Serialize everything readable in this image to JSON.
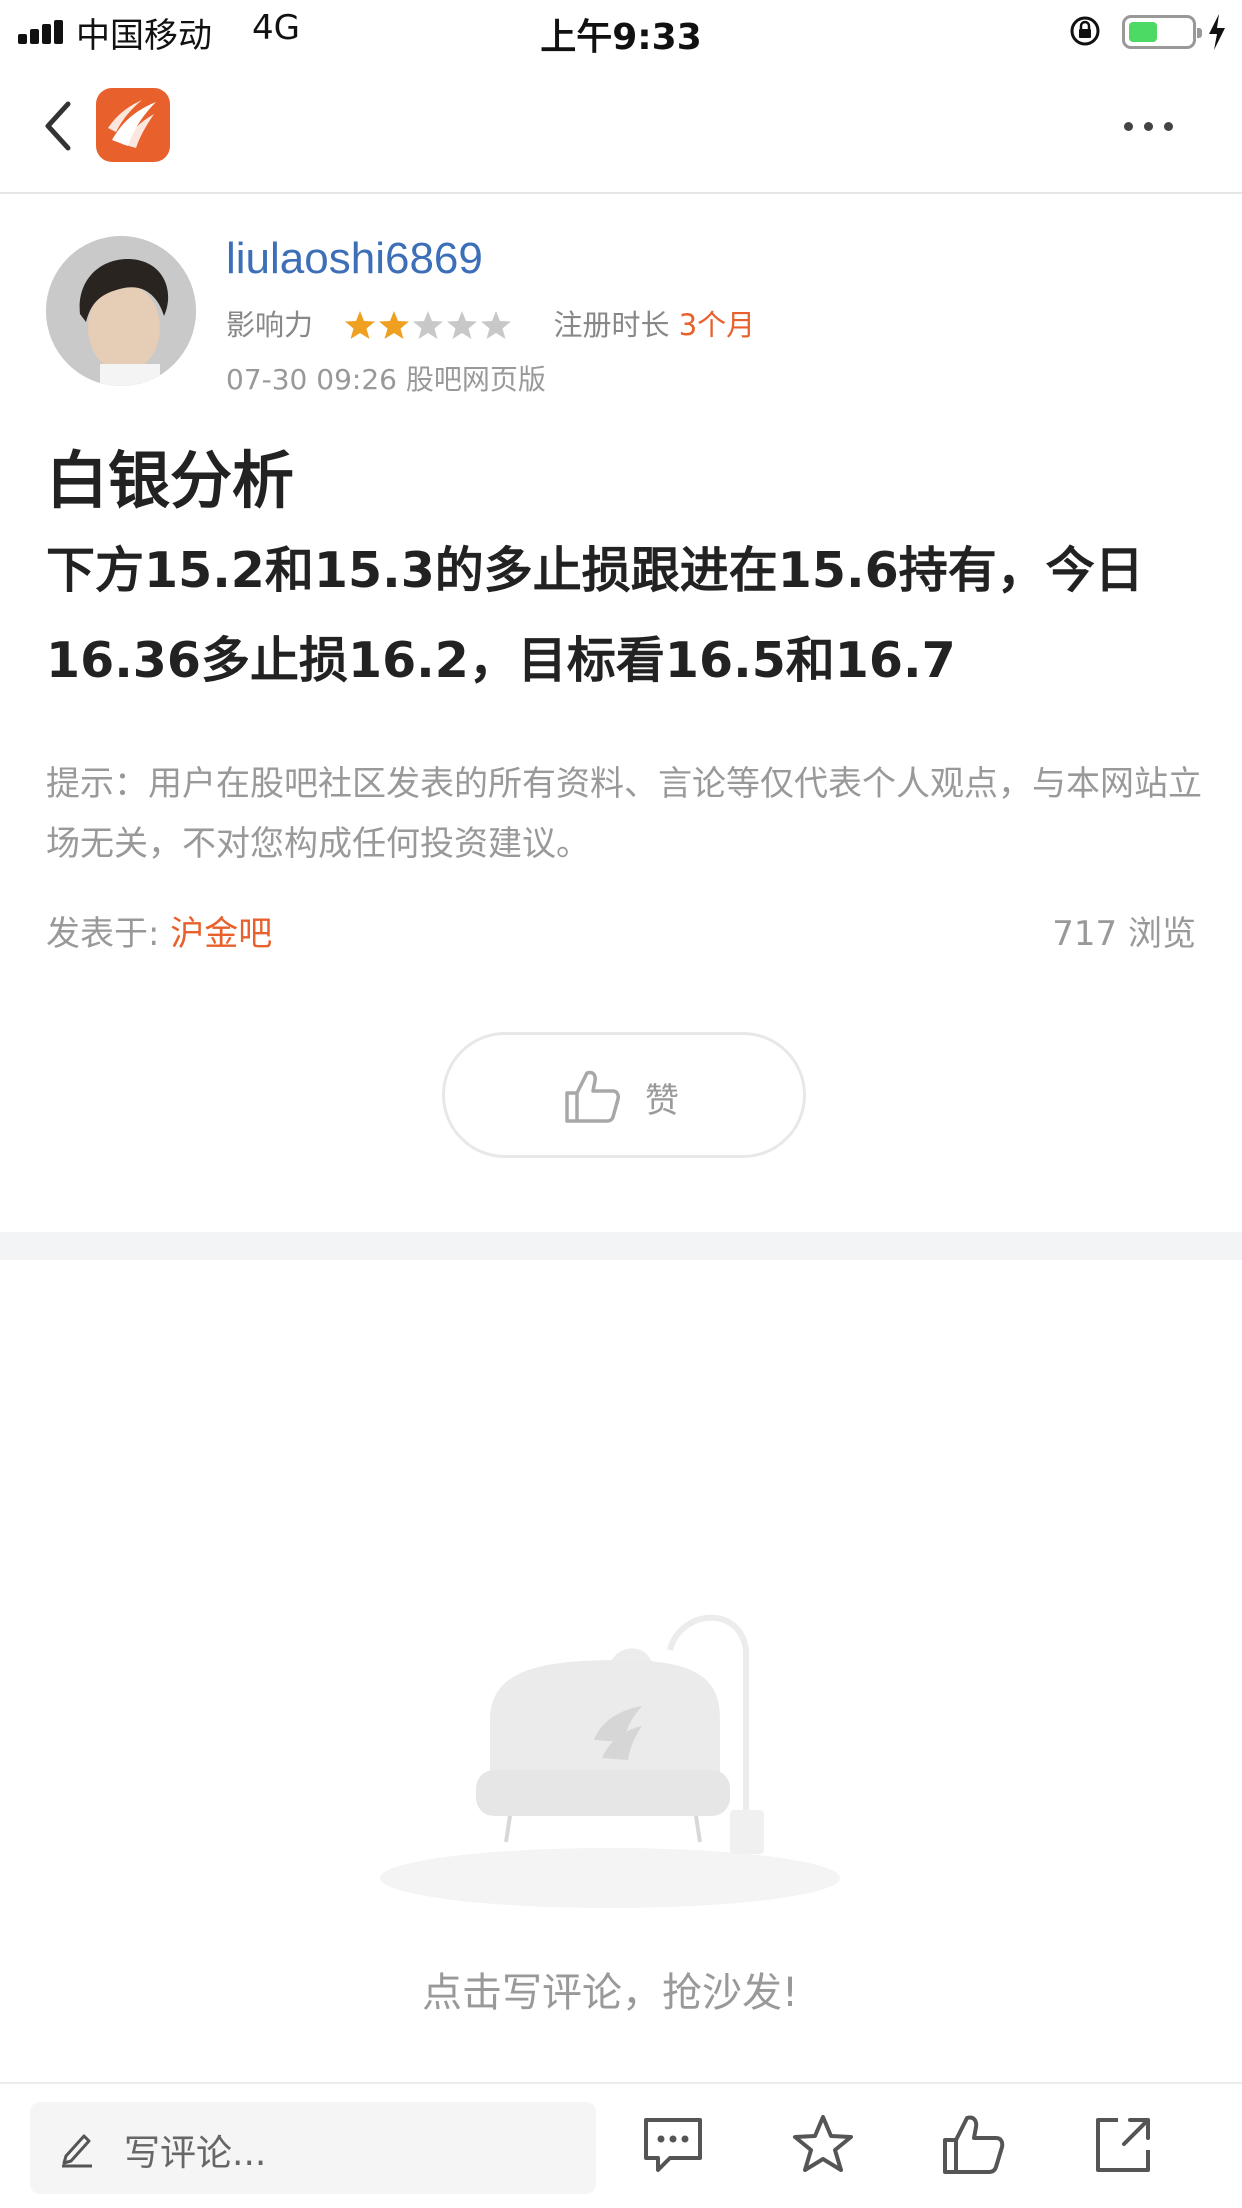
{
  "status_bar": {
    "carrier": "中国移动",
    "network": "4G",
    "time": "上午9:33",
    "battery_level": 0.45
  },
  "nav": {
    "back_icon": "chevron-left-icon",
    "logo_icon": "app-logo-icon",
    "more_icon": "more-dots-icon"
  },
  "author": {
    "username": "liulaoshi6869",
    "influence_label": "影响力",
    "influence_rating": 2,
    "influence_max": 5,
    "registration_label": "注册时长",
    "registration_value": "3个月",
    "post_time": "07-30 09:26",
    "post_source": "股吧网页版"
  },
  "post": {
    "title": "白银分析",
    "body": "下方15.2和15.3的多止损跟进在15.6持有，今日16.36多止损16.2，目标看16.5和16.7",
    "disclaimer": "提示：用户在股吧社区发表的所有资料、言论等仅代表个人观点，与本网站立场无关，不对您构成任何投资建议。",
    "posted_in_label": "发表于: ",
    "posted_in_bar": "沪金吧",
    "views": "717 浏览"
  },
  "like_button": {
    "label": "赞",
    "icon": "thumbs-up-icon"
  },
  "empty_state": {
    "prompt": "点击写评论，抢沙发!",
    "illustration": "sofa-lamp-illustration"
  },
  "bottom_bar": {
    "comment_placeholder": "写评论...",
    "icons": [
      "edit-pen-icon",
      "comment-icon",
      "star-icon",
      "thumbs-up-icon",
      "share-icon"
    ]
  },
  "colors": {
    "accent": "#e8612c",
    "link_blue": "#3c6fb8",
    "star_gold": "#f0a020",
    "star_gray": "#c8c8c8",
    "text_gray": "#999999"
  }
}
